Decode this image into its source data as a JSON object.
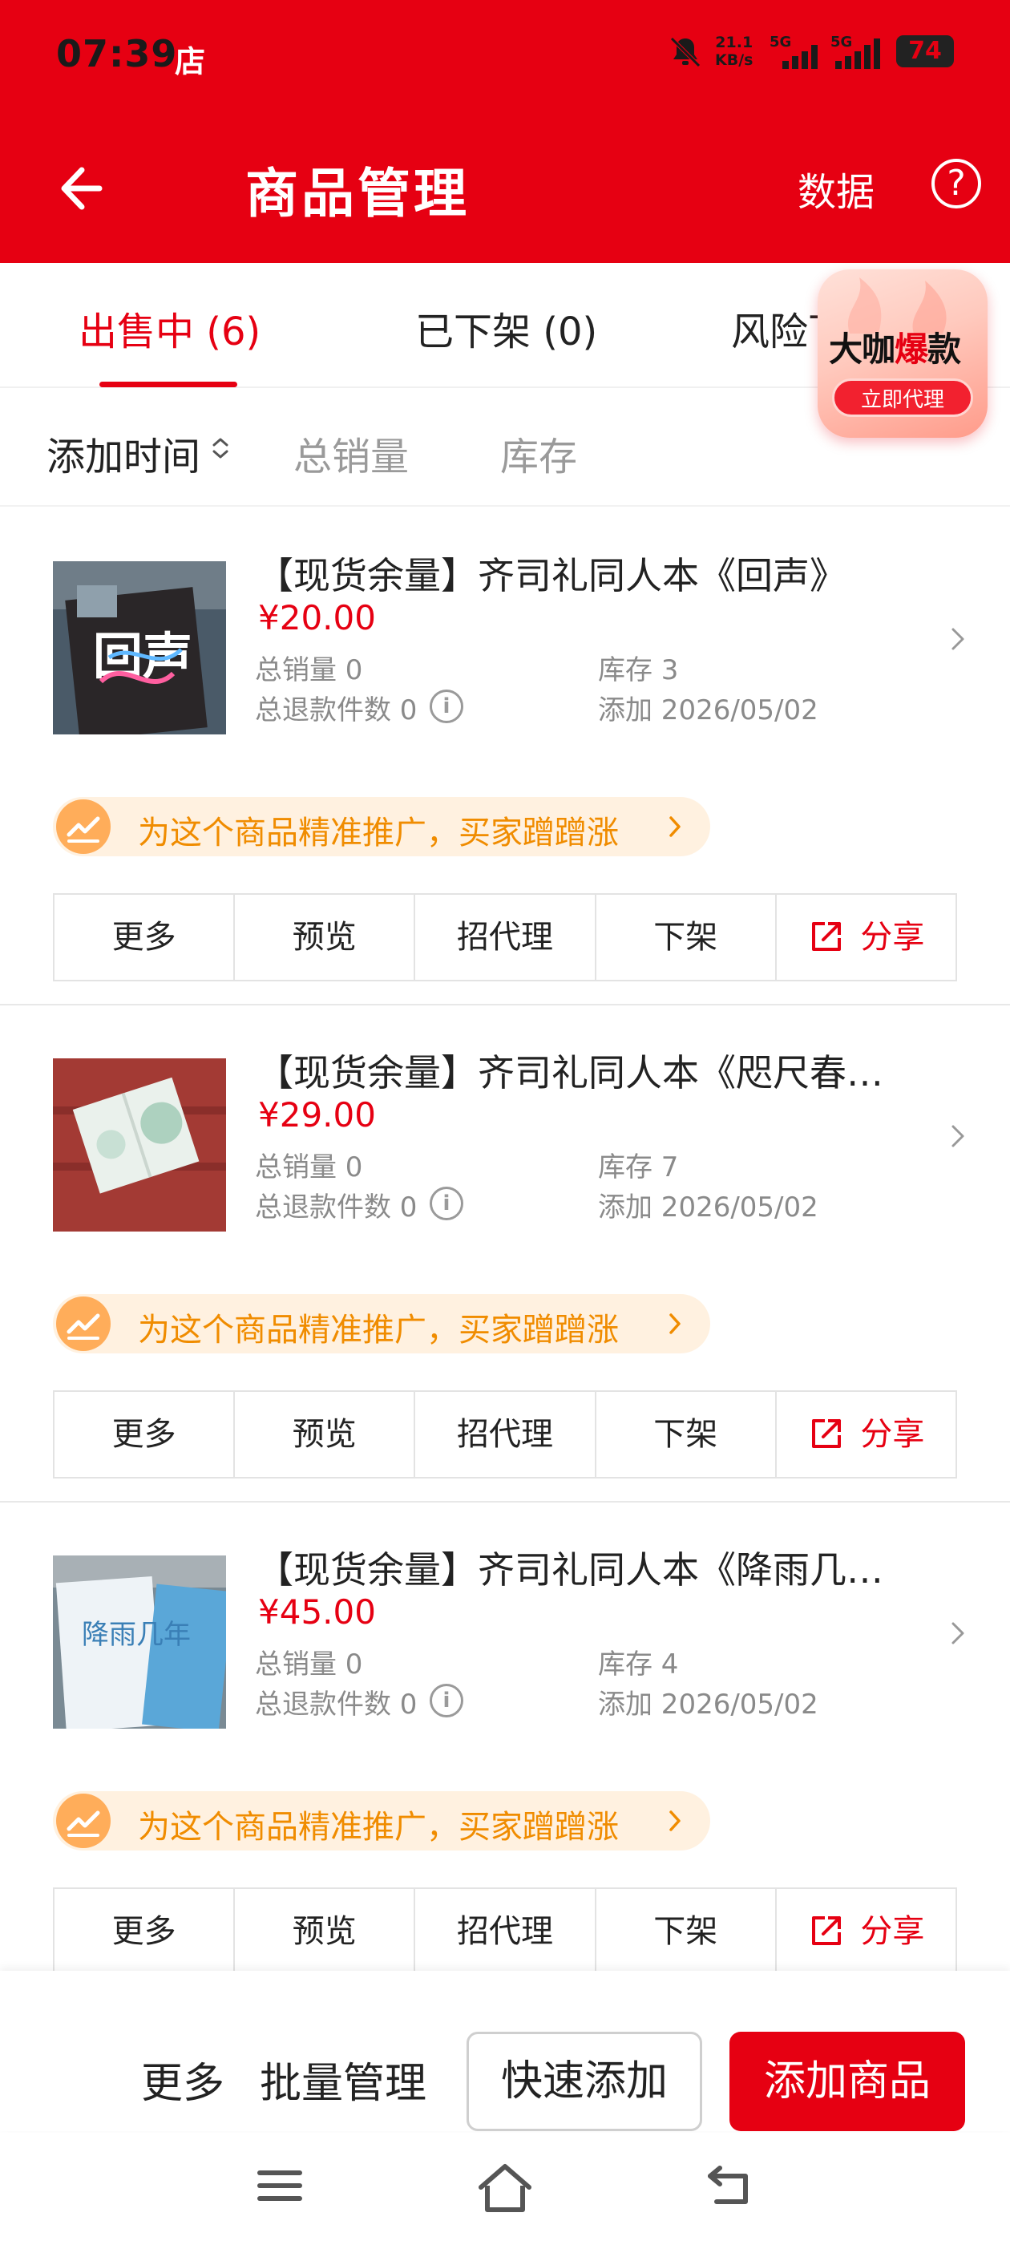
{
  "status_bar": {
    "time": "07:39",
    "shop_glyph": "店",
    "speed_value": "21.1",
    "speed_unit": "KB/s",
    "signal1": "5G",
    "signal2": "5G",
    "battery": "74"
  },
  "header": {
    "title": "商品管理",
    "data_link": "数据",
    "help": "?"
  },
  "tabs": [
    {
      "label": "出售中 (6)",
      "active": true
    },
    {
      "label": "已下架 (0)",
      "active": false
    },
    {
      "label": "风险下",
      "active": false
    }
  ],
  "promo_badge": {
    "title_a": "大咖",
    "title_b": "爆",
    "title_c": "款",
    "button": "立即代理"
  },
  "filters": [
    {
      "label": "添加时间",
      "active": true
    },
    {
      "label": "总销量",
      "active": false
    },
    {
      "label": "库存",
      "active": false
    }
  ],
  "products": [
    {
      "name": "【现货余量】齐司礼同人本《回声》",
      "price": "¥20.00",
      "sales": "总销量 0",
      "stock": "库存 3",
      "refunds": "总退款件数 0",
      "added": "添加 2026/05/02"
    },
    {
      "name": "【现货余量】齐司礼同人本《咫尺春…",
      "price": "¥29.00",
      "sales": "总销量 0",
      "stock": "库存 7",
      "refunds": "总退款件数 0",
      "added": "添加 2026/05/02"
    },
    {
      "name": "【现货余量】齐司礼同人本《降雨几…",
      "price": "¥45.00",
      "sales": "总销量 0",
      "stock": "库存 4",
      "refunds": "总退款件数 0",
      "added": "添加 2026/05/02"
    }
  ],
  "boost_text": "为这个商品精准推广，买家蹭蹭涨",
  "card_actions": [
    "更多",
    "预览",
    "招代理",
    "下架",
    "分享"
  ],
  "bottom_bar": {
    "more": "更多",
    "batch": "批量管理",
    "quick_add": "快速添加",
    "add_product": "添加商品"
  },
  "thumb_text": {
    "p1": "回声",
    "p3": "降雨几年"
  },
  "colors": {
    "brand_red": "#e60012",
    "boost_orange": "#f08c00"
  }
}
